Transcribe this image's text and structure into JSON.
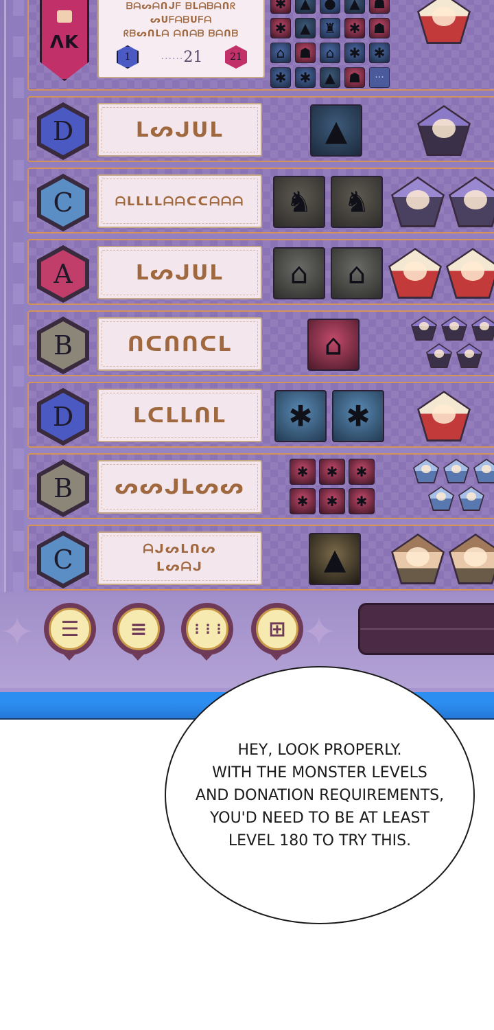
{
  "top_row": {
    "banner_text": "ΛΚ",
    "rune_lines": [
      "ᗷᗩᔕᗩᑎᒍᖴ ᗷᒪᗩᗷᗩᑎᖇ",
      "ᔕᑌᖴᗩᗷᑌᖴᗩ",
      "ᖇᗷᔕᑎᒪᗩ ᗩᑎᗩᗷ ᗷᗩᑎᗷ"
    ],
    "pager": {
      "first": "1",
      "current": "21",
      "last": "21",
      "dots": "······"
    },
    "more_label": "···"
  },
  "rows": [
    {
      "rank": "D",
      "rune": "ᒪᔕᒍᑌᒪ",
      "rune_size": "big"
    },
    {
      "rank": "C",
      "rune": "ᗩᒪᒪᒪᒪᗩᗩᑕᑕᗩᗩᗩ",
      "rune_size": "small"
    },
    {
      "rank": "A",
      "rune": "ᒪᔕᒍᑌᒪ",
      "rune_size": "big"
    },
    {
      "rank": "B",
      "rune": "ᑎᑕᑎᑎᑕᒪ",
      "rune_size": "big"
    },
    {
      "rank": "D",
      "rune": "ᒪᑕᒪᒪᑎᒪ",
      "rune_size": "big"
    },
    {
      "rank": "B",
      "rune": "ᔕᔕᒍᒪᔕᔕ",
      "rune_size": "big"
    },
    {
      "rank": "C",
      "rune": "ᗩᒍᔕᒪᑎᔕ ᒪᔕᗩᒍ",
      "rune_size": "small"
    }
  ],
  "controls": [
    {
      "name": "menu-lines",
      "glyph": "☰"
    },
    {
      "name": "list",
      "glyph": "≡"
    },
    {
      "name": "grid-nine",
      "glyph": "⋮⋮⋮"
    },
    {
      "name": "grid-four",
      "glyph": "⊞"
    }
  ],
  "bubble_text": "HEY, LOOK PROPERLY.\nWITH THE MONSTER LEVELS\nAND DONATION REQUIREMENTS,\nYOU'D NEED TO BE AT LEAST\nLEVEL 180 TO TRY THIS.",
  "colors": {
    "rank_D": "#4a5ac2",
    "rank_C": "#5a8ec4",
    "rank_A": "#c23e6a",
    "rank_B": "#8c8678",
    "panel": "#8b74b6",
    "row_border": "#d4935a",
    "blue_strip": "#2c8ef0"
  }
}
